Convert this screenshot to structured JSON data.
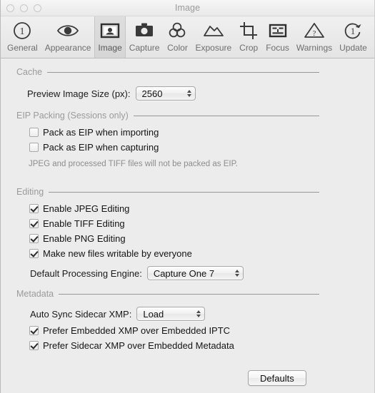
{
  "window": {
    "title": "Image",
    "traffic_lights": [
      "close",
      "minimize",
      "zoom"
    ]
  },
  "toolbar": {
    "tabs": [
      {
        "label": "General",
        "icon": "numbered-circle-one-icon",
        "selected": false
      },
      {
        "label": "Appearance",
        "icon": "eye-icon",
        "selected": false
      },
      {
        "label": "Image",
        "icon": "portrait-frame-icon",
        "selected": true
      },
      {
        "label": "Capture",
        "icon": "camera-icon",
        "selected": false
      },
      {
        "label": "Color",
        "icon": "three-circles-icon",
        "selected": false
      },
      {
        "label": "Exposure",
        "icon": "curve-icon",
        "selected": false
      },
      {
        "label": "Crop",
        "icon": "crop-marks-icon",
        "selected": false
      },
      {
        "label": "Focus",
        "icon": "grid-box-icon",
        "selected": false
      },
      {
        "label": "Warnings",
        "icon": "warning-triangle-icon",
        "selected": false
      },
      {
        "label": "Update",
        "icon": "refresh-one-icon",
        "selected": false
      }
    ]
  },
  "sections": {
    "cache": {
      "title": "Cache",
      "preview_size_label": "Preview Image Size (px):",
      "preview_size_value": "2560"
    },
    "eip": {
      "title": "EIP Packing (Sessions only)",
      "pack_importing_label": "Pack as EIP when importing",
      "pack_importing_checked": false,
      "pack_capturing_label": "Pack as EIP when capturing",
      "pack_capturing_checked": false,
      "note": "JPEG and processed TIFF files will not be packed as EIP."
    },
    "editing": {
      "title": "Editing",
      "jpeg_label": "Enable JPEG Editing",
      "jpeg_checked": true,
      "tiff_label": "Enable TIFF Editing",
      "tiff_checked": true,
      "png_label": "Enable PNG Editing",
      "png_checked": true,
      "writable_label": "Make new files writable by everyone",
      "writable_checked": true,
      "engine_label": "Default Processing Engine:",
      "engine_value": "Capture One 7"
    },
    "metadata": {
      "title": "Metadata",
      "autosync_label": "Auto Sync Sidecar XMP:",
      "autosync_value": "Load",
      "prefer_xmp_label": "Prefer Embedded XMP over Embedded IPTC",
      "prefer_xmp_checked": true,
      "prefer_sidecar_label": "Prefer Sidecar XMP over Embedded Metadata",
      "prefer_sidecar_checked": true
    }
  },
  "footer": {
    "defaults_label": "Defaults"
  },
  "colors": {
    "window_bg": "#ececec",
    "titlebar_top": "#f6f6f6",
    "section_label": "#9b9b9b",
    "rule": "#989898",
    "text": "#141414",
    "note": "#8d8d8d"
  }
}
